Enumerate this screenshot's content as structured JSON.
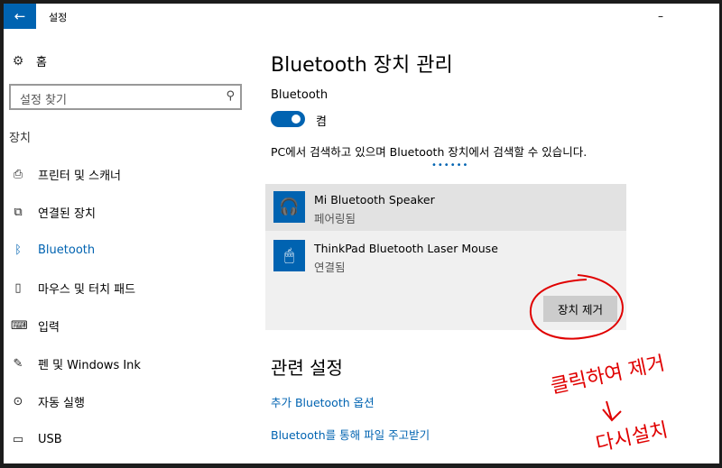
{
  "titlebar": {
    "title": "설정",
    "back_icon": "arrow-left-icon",
    "minimize_label": "–"
  },
  "sidebar": {
    "home_label": "홈",
    "search_placeholder": "설정 찾기",
    "section_label": "장치",
    "items": [
      {
        "label": "프린터 및 스캐너",
        "icon": "printer-icon",
        "glyph": "⎙"
      },
      {
        "label": "연결된 장치",
        "icon": "connected-devices-icon",
        "glyph": "⧉"
      },
      {
        "label": "Bluetooth",
        "icon": "bluetooth-icon",
        "glyph": "ᛒ",
        "active": true
      },
      {
        "label": "마우스 및 터치 패드",
        "icon": "mouse-icon",
        "glyph": "▯"
      },
      {
        "label": "입력",
        "icon": "keyboard-icon",
        "glyph": "⌨"
      },
      {
        "label": "펜 및 Windows Ink",
        "icon": "pen-icon",
        "glyph": "✎"
      },
      {
        "label": "자동 실행",
        "icon": "autoplay-icon",
        "glyph": "⊙"
      },
      {
        "label": "USB",
        "icon": "usb-icon",
        "glyph": "▭"
      }
    ]
  },
  "main": {
    "title": "Bluetooth 장치 관리",
    "bluetooth_label": "Bluetooth",
    "toggle_state": "켬",
    "description": "PC에서 검색하고 있으며 Bluetooth 장치에서 검색할 수 있습니다.",
    "progress_dots": "••••••",
    "devices": [
      {
        "name": "Mi Bluetooth Speaker",
        "status": "페어링됨",
        "icon": "headset-icon",
        "glyph": "🎧",
        "selected": true
      },
      {
        "name": "ThinkPad Bluetooth Laser Mouse",
        "status": "연결됨",
        "icon": "mouse-device-icon",
        "glyph": "🖱",
        "selected": false
      }
    ],
    "remove_button": "장치 제거",
    "related_title": "관련 설정",
    "links": [
      "추가 Bluetooth 옵션",
      "Bluetooth를 통해 파일 주고받기"
    ]
  },
  "annotation": {
    "line1": "클릭하여 제거",
    "line2": "다시설치",
    "color": "#e00000"
  },
  "colors": {
    "accent": "#0063b1"
  }
}
